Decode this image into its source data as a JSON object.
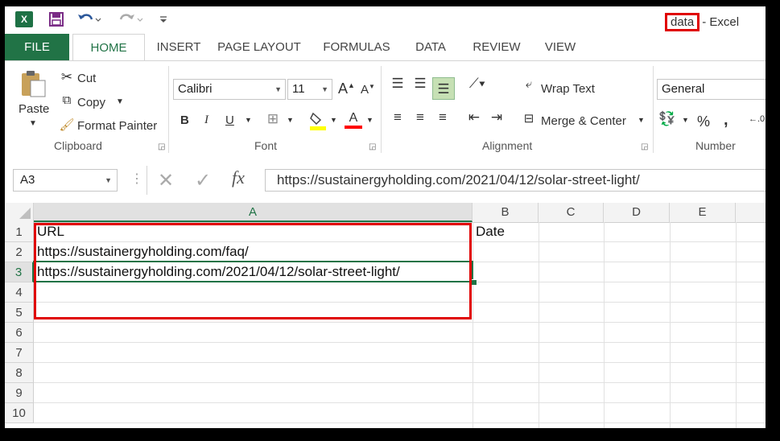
{
  "window": {
    "doc_name": "data",
    "app_suffix": "- Excel"
  },
  "quick_access": {
    "logo": "X",
    "save_icon": "save-icon",
    "undo_icon": "undo-icon",
    "redo_icon": "redo-icon"
  },
  "tabs": [
    "FILE",
    "HOME",
    "INSERT",
    "PAGE LAYOUT",
    "FORMULAS",
    "DATA",
    "REVIEW",
    "VIEW"
  ],
  "clipboard": {
    "paste": "Paste",
    "cut": "Cut",
    "copy": "Copy",
    "format_painter": "Format Painter",
    "group": "Clipboard"
  },
  "font": {
    "name": "Calibri",
    "size": "11",
    "grow": "A",
    "shrink": "A",
    "bold": "B",
    "italic": "I",
    "underline": "U",
    "font_color_letter": "A",
    "group": "Font",
    "highlight_color": "#ffff00",
    "font_color": "#ff0000"
  },
  "alignment": {
    "wrap_text": "Wrap Text",
    "merge_center": "Merge & Center",
    "group": "Alignment"
  },
  "number": {
    "format": "General",
    "percent": "%",
    "comma": ",",
    "group": "Number"
  },
  "formula_bar": {
    "name_box": "A3",
    "fx": "fx",
    "formula": "https://sustainergyholding.com/2021/04/12/solar-street-light/"
  },
  "columns": [
    "A",
    "B",
    "C",
    "D",
    "E"
  ],
  "rows": [
    "1",
    "2",
    "3",
    "4",
    "5",
    "6",
    "7",
    "8",
    "9",
    "10"
  ],
  "cells": {
    "A1": "URL",
    "B1": "Date",
    "A2": "https://sustainergyholding.com/faq/",
    "A3": "https://sustainergyholding.com/2021/04/12/solar-street-light/"
  },
  "colors": {
    "excel_green": "#217346",
    "highlight_red": "#e00000",
    "selection_green": "#217346"
  }
}
